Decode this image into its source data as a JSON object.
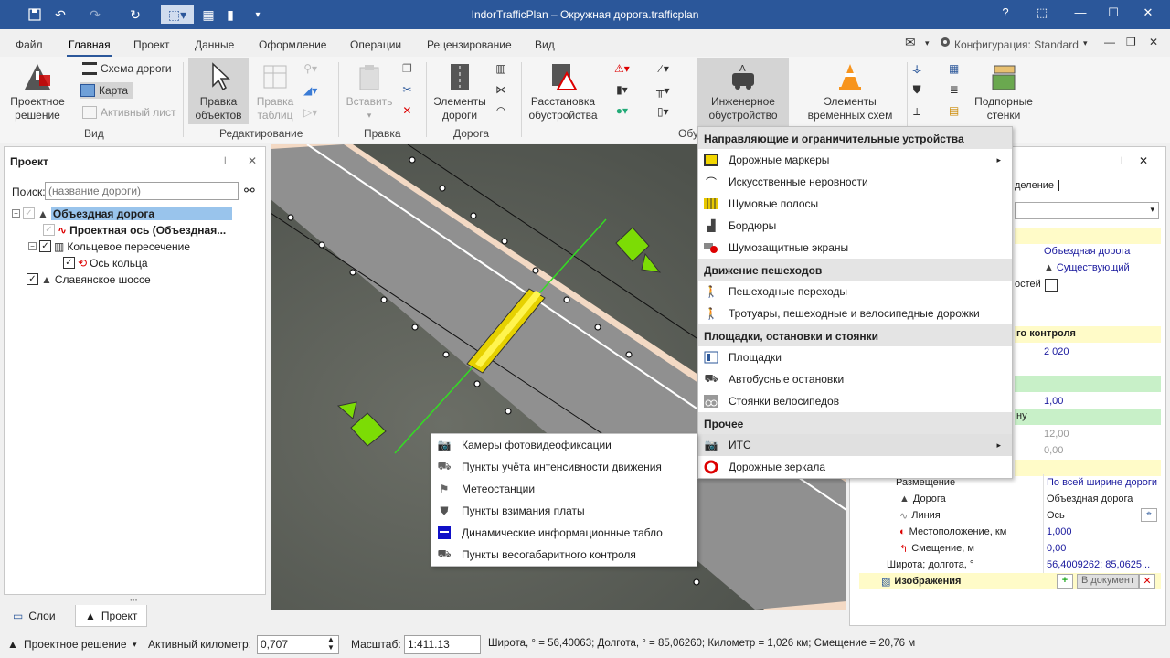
{
  "app": {
    "title": "IndorTrafficPlan – Окружная дорога.trafficplan"
  },
  "menu": {
    "tabs": [
      "Файл",
      "Главная",
      "Проект",
      "Данные",
      "Оформление",
      "Операции",
      "Рецензирование",
      "Вид"
    ],
    "active": "Главная",
    "mail": "✉",
    "config": "Конфигурация: Standard"
  },
  "ribbon": {
    "design_solution": "Проектное\nрешение",
    "road_scheme": "Схема дороги",
    "map": "Карта",
    "active_sheet": "Активный лист",
    "edit_objects": "Правка\nобъектов",
    "edit_table": "Правка\nтаблиц",
    "paste": "Вставить",
    "road_elements": "Элементы\nдороги",
    "placement": "Расстановка\nобустройства",
    "engineering": "Инженерное\nобустройство",
    "temp_elements": "Элементы\nвременных схем",
    "retaining": "Подпорные\nстенки",
    "groups": {
      "view": "Вид",
      "editing": "Редактирование",
      "edit": "Правка",
      "road": "Дорога",
      "obu": "Обу"
    }
  },
  "left_panel": {
    "title": "Проект",
    "search_label": "Поиск:",
    "search_placeholder": "(название дороги)",
    "tree": [
      {
        "label": "Объездная дорога",
        "bold": true,
        "selected": true
      },
      {
        "label": "Проектная ось (Объездная...",
        "bold": true
      },
      {
        "label": "Кольцевое пересечение"
      },
      {
        "label": "Ось кольца"
      },
      {
        "label": "Славянское шоссе"
      }
    ]
  },
  "bottom_tabs": [
    "Слои",
    "Проект"
  ],
  "right_panel": {
    "tab_fragment": "деление",
    "values": {
      "road": "Объездная дорога",
      "status": "Существующий",
      "frag_speed": "остей",
      "frag_control": "го контроля",
      "year": "2 020",
      "one": "1,00",
      "frag_direction": "ну",
      "v12": "12,00",
      "v0": "0,00"
    },
    "props": [
      {
        "k": "Размещение",
        "v": "По всей ширине дороги"
      },
      {
        "k": "Дорога",
        "v": "Объездная дорога"
      },
      {
        "k": "Линия",
        "v": "Ось"
      },
      {
        "k": "Местоположение, км",
        "v": "1,000"
      },
      {
        "k": "Смещение, м",
        "v": "0,00"
      },
      {
        "k": "Широта; долгота, °",
        "v": "56,4009262; 85,0625..."
      }
    ],
    "images_label": "Изображения",
    "to_doc": "В документ"
  },
  "its_menu": {
    "sections": [
      {
        "header": "Направляющие и ограничительные устройства",
        "items": [
          "Дорожные маркеры",
          "Искусственные неровности",
          "Шумовые полосы",
          "Бордюры",
          "Шумозащитные экраны"
        ]
      },
      {
        "header": "Движение пешеходов",
        "items": [
          "Пешеходные переходы",
          "Тротуары, пешеходные и велосипедные дорожки"
        ]
      },
      {
        "header": "Площадки, остановки и стоянки",
        "items": [
          "Площадки",
          "Автобусные остановки",
          "Стоянки велосипедов"
        ]
      },
      {
        "header": "Прочее",
        "items": [
          "ИТС",
          "Дорожные зеркала"
        ]
      }
    ]
  },
  "its_submenu": [
    "Камеры фотовидеофиксации",
    "Пункты учёта интенсивности движения",
    "Метеостанции",
    "Пункты взимания платы",
    "Динамические информационные табло",
    "Пункты весогабаритного контроля"
  ],
  "status": {
    "mode": "Проектное решение",
    "active_km_label": "Активный километр:",
    "active_km": "0,707",
    "scale_label": "Масштаб:",
    "scale": "1:411.13",
    "coords": "Широта, ° = 56,40063; Долгота, ° = 85,06260; Километр = 1,026 км; Смещение = 20,76 м"
  }
}
